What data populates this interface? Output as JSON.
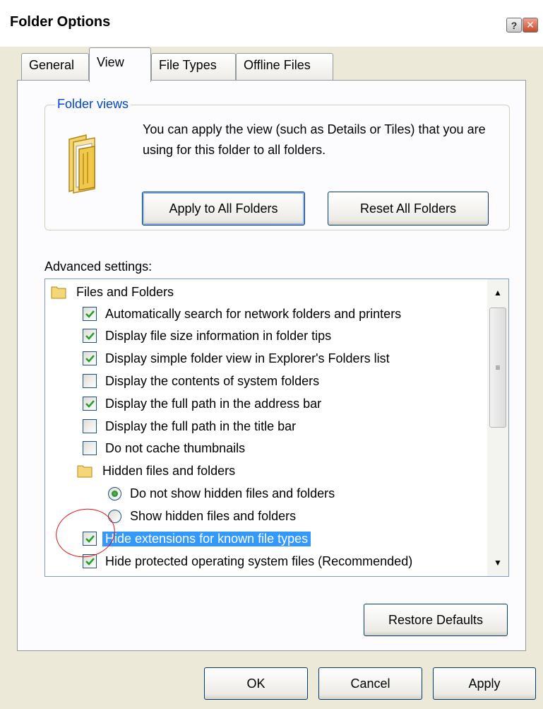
{
  "window": {
    "title": "Folder Options",
    "help_glyph": "?",
    "close_glyph": "✕"
  },
  "tabs": [
    {
      "label": "General"
    },
    {
      "label": "View",
      "active": true
    },
    {
      "label": "File Types"
    },
    {
      "label": "Offline Files"
    }
  ],
  "folder_views": {
    "legend": "Folder views",
    "description": "You can apply the view (such as Details or Tiles) that you are using for this folder to all folders.",
    "apply_label": "Apply to All Folders",
    "reset_label": "Reset All Folders",
    "icon": "folder-icon"
  },
  "advanced": {
    "label": "Advanced settings:",
    "items": [
      {
        "type": "folder",
        "label": "Files and Folders",
        "indent": 0
      },
      {
        "type": "checkbox",
        "label": "Automatically search for network folders and printers",
        "checked": true
      },
      {
        "type": "checkbox",
        "label": "Display file size information in folder tips",
        "checked": true
      },
      {
        "type": "checkbox",
        "label": "Display simple folder view in Explorer's Folders list",
        "checked": true
      },
      {
        "type": "checkbox",
        "label": "Display the contents of system folders",
        "checked": false
      },
      {
        "type": "checkbox",
        "label": "Display the full path in the address bar",
        "checked": true
      },
      {
        "type": "checkbox",
        "label": "Display the full path in the title bar",
        "checked": false
      },
      {
        "type": "checkbox",
        "label": "Do not cache thumbnails",
        "checked": false
      },
      {
        "type": "folder",
        "label": "Hidden files and folders",
        "indent": 1
      },
      {
        "type": "radio",
        "label": "Do not show hidden files and folders",
        "checked": true
      },
      {
        "type": "radio",
        "label": "Show hidden files and folders",
        "checked": false
      },
      {
        "type": "checkbox",
        "label": "Hide extensions for known file types",
        "checked": true,
        "selected": true
      },
      {
        "type": "checkbox",
        "label": "Hide protected operating system files (Recommended)",
        "checked": true
      }
    ]
  },
  "buttons": {
    "restore_defaults": "Restore Defaults",
    "ok": "OK",
    "cancel": "Cancel",
    "apply": "Apply"
  },
  "colors": {
    "selection": "#3399ff",
    "annotation": "#e01010",
    "legend": "#0046d5"
  }
}
